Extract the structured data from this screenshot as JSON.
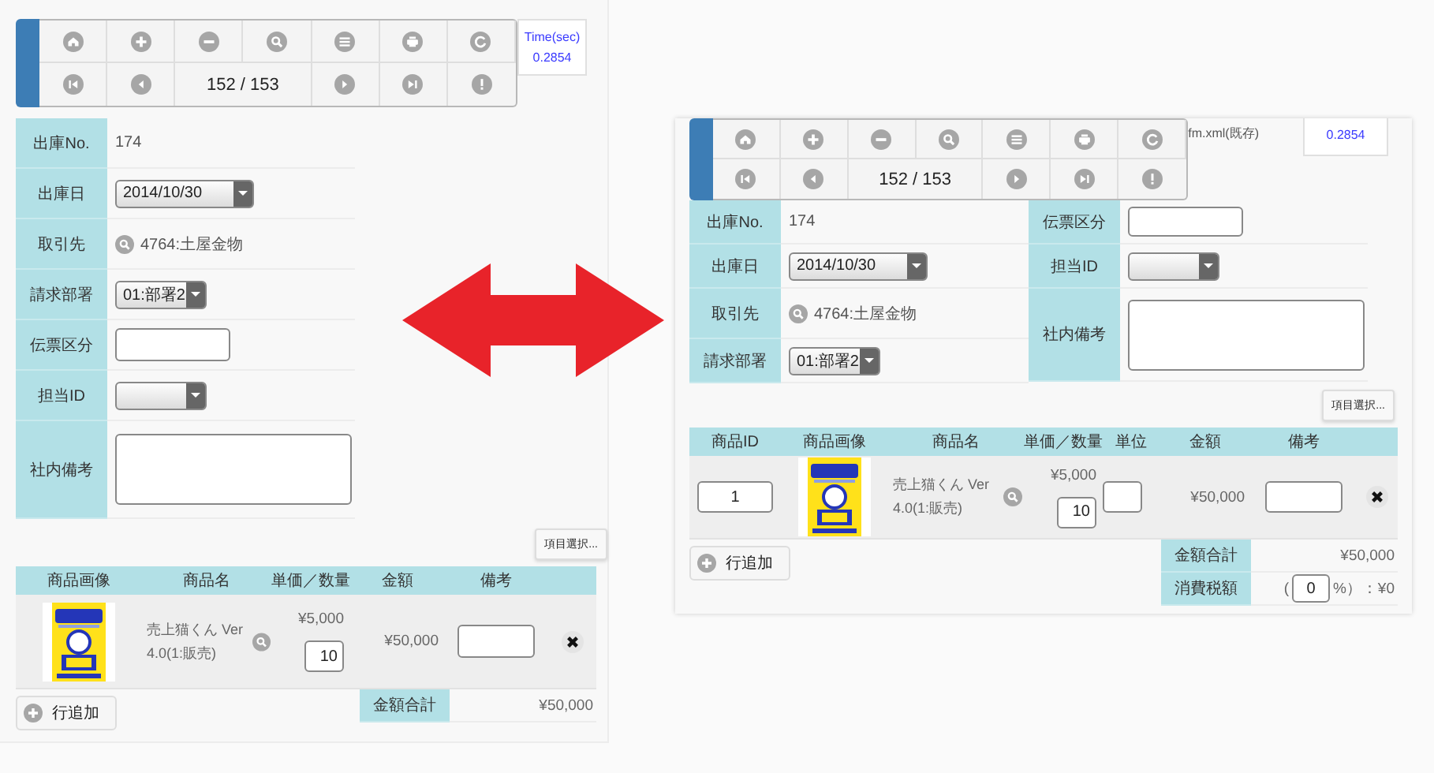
{
  "screens": [
    {
      "kind": "portrait",
      "toolbar": {
        "page": "152 / 153"
      },
      "timer": {
        "label": "Time(sec)",
        "value": "0.2854"
      },
      "form_columns": [
        [
          {
            "label": "出庫No.",
            "kind": "text",
            "value": "174"
          },
          {
            "label": "出庫日",
            "kind": "date_select",
            "value": "2014/10/30"
          },
          {
            "label": "取引先",
            "kind": "lookup",
            "value": "4764:土屋金物"
          },
          {
            "label": "請求部署",
            "kind": "select",
            "value": "01:部署2"
          },
          {
            "label": "伝票区分",
            "kind": "input"
          },
          {
            "label": "担当ID",
            "kind": "select"
          },
          {
            "label": "社内備考",
            "kind": "textarea"
          }
        ]
      ],
      "item_select": "項目選択...",
      "table": {
        "columns": [
          "商品画像",
          "商品名",
          "単価／数量",
          "金額",
          "備考"
        ],
        "rows": [
          {
            "cells": [
              {
                "kind": "picture"
              },
              {
                "kind": "product",
                "value": "売上猫くん Ver 4.0(1:販売)"
              },
              {
                "kind": "price_qty",
                "price": "¥5,000",
                "qty": "10"
              },
              {
                "kind": "amount",
                "value": "¥50,000"
              },
              {
                "kind": "note"
              },
              {
                "kind": "delete"
              }
            ]
          }
        ]
      },
      "add_row": "行追加",
      "summary": [
        {
          "kind": "total",
          "label": "金額合計",
          "value": "¥50,000"
        }
      ]
    },
    {
      "kind": "landscape",
      "toolbar": {
        "page": "152 / 153"
      },
      "file_label": "fm.xml(既存)",
      "timer": {
        "value": "0.2854"
      },
      "form_columns": [
        [
          {
            "label": "出庫No.",
            "kind": "text",
            "value": "174"
          },
          {
            "label": "出庫日",
            "kind": "date_select",
            "value": "2014/10/30"
          },
          {
            "label": "取引先",
            "kind": "lookup",
            "value": "4764:土屋金物"
          },
          {
            "label": "請求部署",
            "kind": "select",
            "value": "01:部署2"
          }
        ],
        [
          {
            "label": "伝票区分",
            "kind": "input"
          },
          {
            "label": "担当ID",
            "kind": "select"
          },
          {
            "label": "社内備考",
            "kind": "textarea"
          }
        ]
      ],
      "item_select": "項目選択...",
      "table": {
        "columns": [
          "商品ID",
          "商品画像",
          "商品名",
          "単価／数量",
          "単位",
          "金額",
          "備考"
        ],
        "rows": [
          {
            "cells": [
              {
                "kind": "id",
                "value": "1"
              },
              {
                "kind": "picture"
              },
              {
                "kind": "product",
                "value": "売上猫くん Ver 4.0(1:販売)"
              },
              {
                "kind": "price_qty",
                "price": "¥5,000",
                "qty": "10"
              },
              {
                "kind": "unit"
              },
              {
                "kind": "amount",
                "value": "¥50,000"
              },
              {
                "kind": "note"
              },
              {
                "kind": "delete"
              }
            ]
          }
        ]
      },
      "add_row": "行追加",
      "summary": [
        {
          "kind": "total",
          "label": "金額合計",
          "value": "¥50,000"
        },
        {
          "kind": "tax",
          "label": "消費税額",
          "before": "(",
          "rate": "0",
          "after": "%）：¥0"
        }
      ]
    }
  ]
}
